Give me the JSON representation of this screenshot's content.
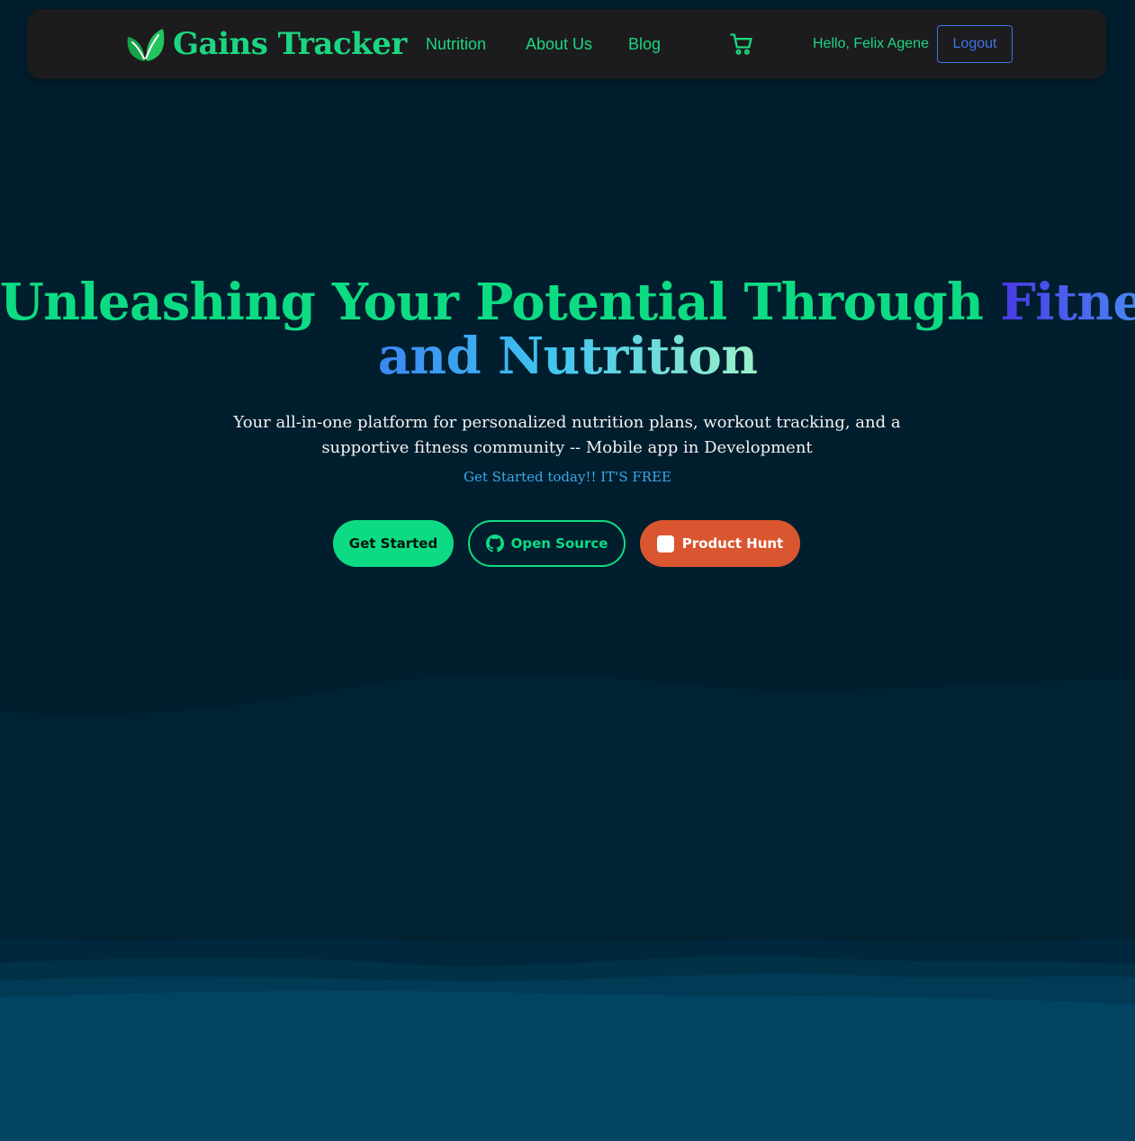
{
  "colors": {
    "page_background": "#001e2d",
    "navbar_background": "#1c1b1d",
    "brand_green": "#1bd681",
    "accent_green": "#0ddb84",
    "logout_blue": "#3f74e6",
    "tagline_blue": "#3aa8e8",
    "product_hunt_orange": "#da5630"
  },
  "navbar": {
    "brand": {
      "name": "Gains Tracker",
      "logo_icon": "leaf-logo-icon"
    },
    "links": [
      "Nutrition",
      "About Us",
      "Blog"
    ],
    "cart_icon": "cart-icon",
    "greeting": "Hello, Felix Agene",
    "logout_label": "Logout"
  },
  "hero": {
    "title": {
      "line1_green": "Unleashing Your Potential Through",
      "line1_gradient": "Fitness",
      "line2_and": "and",
      "line2_nutrition": "Nutrition"
    },
    "subtitle": "Your all-in-one platform for personalized nutrition plans, workout tracking, and a supportive fitness community -- Mobile app in Development",
    "tagline": "Get Started today!! IT'S FREE",
    "buttons": {
      "get_started": "Get Started",
      "open_source": "Open Source",
      "open_source_icon": "github-icon",
      "product_hunt": "Product Hunt",
      "product_hunt_icon": "product-hunt-icon"
    }
  }
}
